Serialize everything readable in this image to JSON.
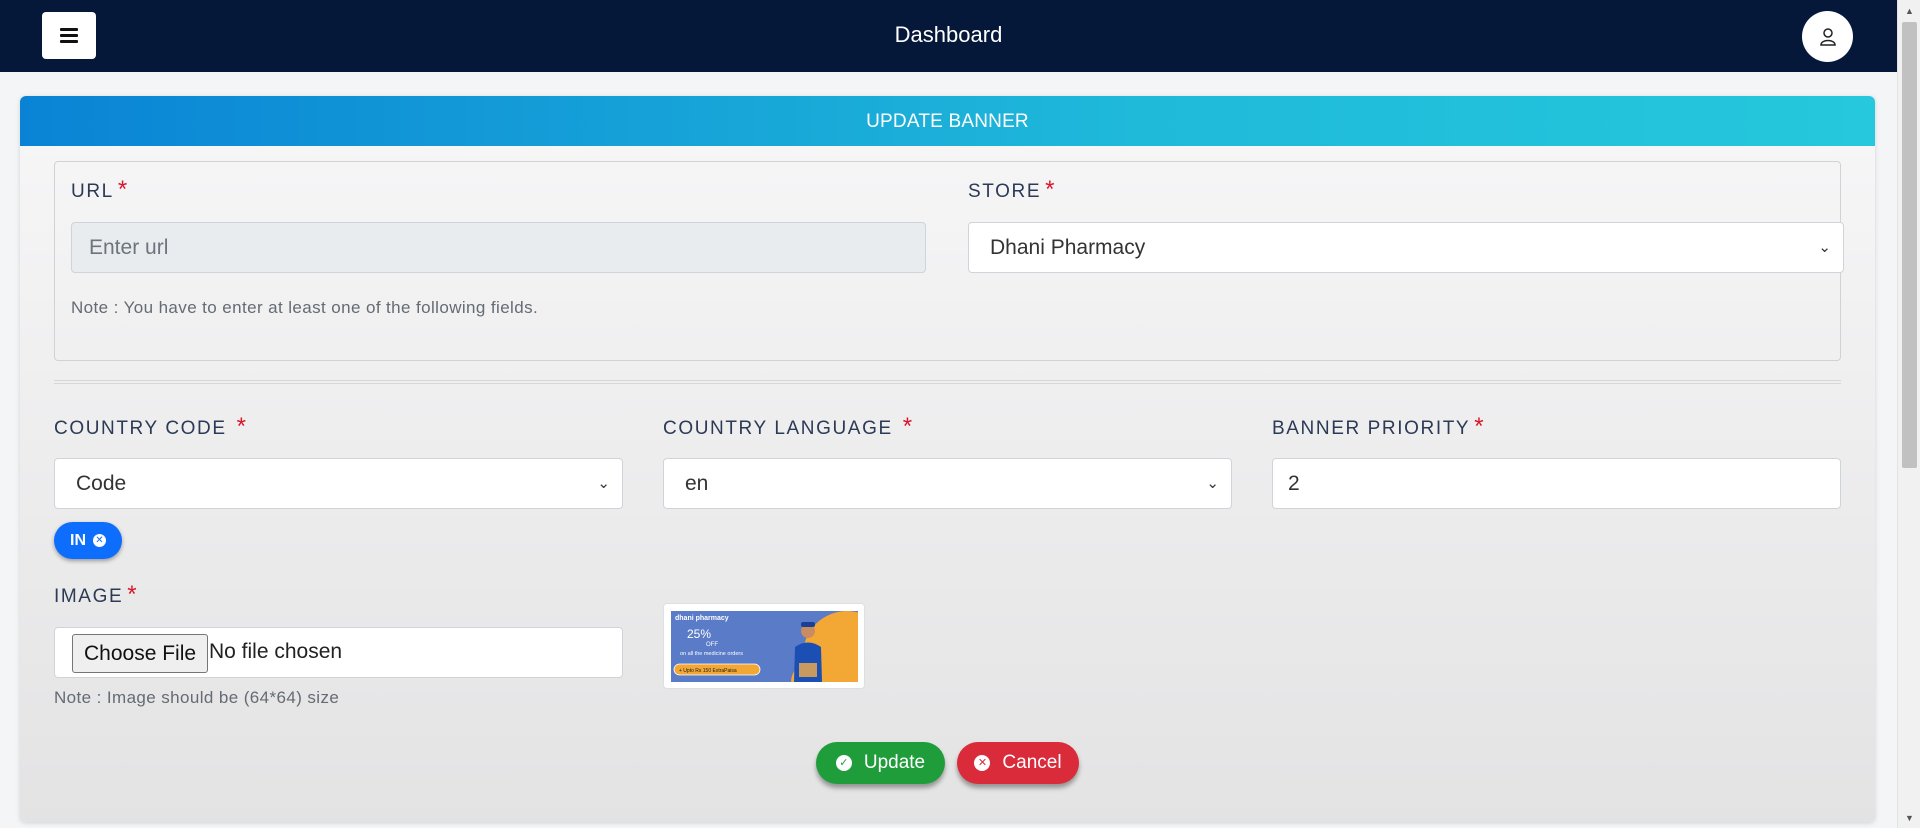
{
  "navbar": {
    "title": "Dashboard",
    "menu_icon": "hamburger-menu-icon",
    "user_icon": "user-icon",
    "background": "#06183a"
  },
  "form": {
    "header": "UPDATE BANNER",
    "url": {
      "label": "URL",
      "placeholder": "Enter url",
      "value": ""
    },
    "store": {
      "label": "STORE",
      "selected": "Dhani Pharmacy"
    },
    "url_note": "Note : You have to enter at least one of the following fields.",
    "country_code": {
      "label": "COUNTRY CODE",
      "selected": "Code",
      "chips": [
        "IN"
      ]
    },
    "country_language": {
      "label": "COUNTRY LANGUAGE",
      "selected": "en"
    },
    "banner_priority": {
      "label": "BANNER PRIORITY",
      "value": "2"
    },
    "image": {
      "label": "IMAGE",
      "choose_button": "Choose File",
      "file_status": "No file chosen",
      "note": "Note : Image should be (64*64) size",
      "preview": {
        "brand": "dhani pharmacy",
        "offer": "25%",
        "off": "OFF",
        "subtext": "on all the medicine orders",
        "pill": "+ Upto Rs 150 ExtraPaisa"
      }
    },
    "buttons": {
      "update": "Update",
      "cancel": "Cancel"
    }
  },
  "colors": {
    "header_gradient_start": "#0a83d5",
    "header_gradient_end": "#25c8dc",
    "required": "#d9162b",
    "chip": "#0d6efd",
    "update": "#1f9d3a",
    "cancel": "#d92b3a"
  }
}
